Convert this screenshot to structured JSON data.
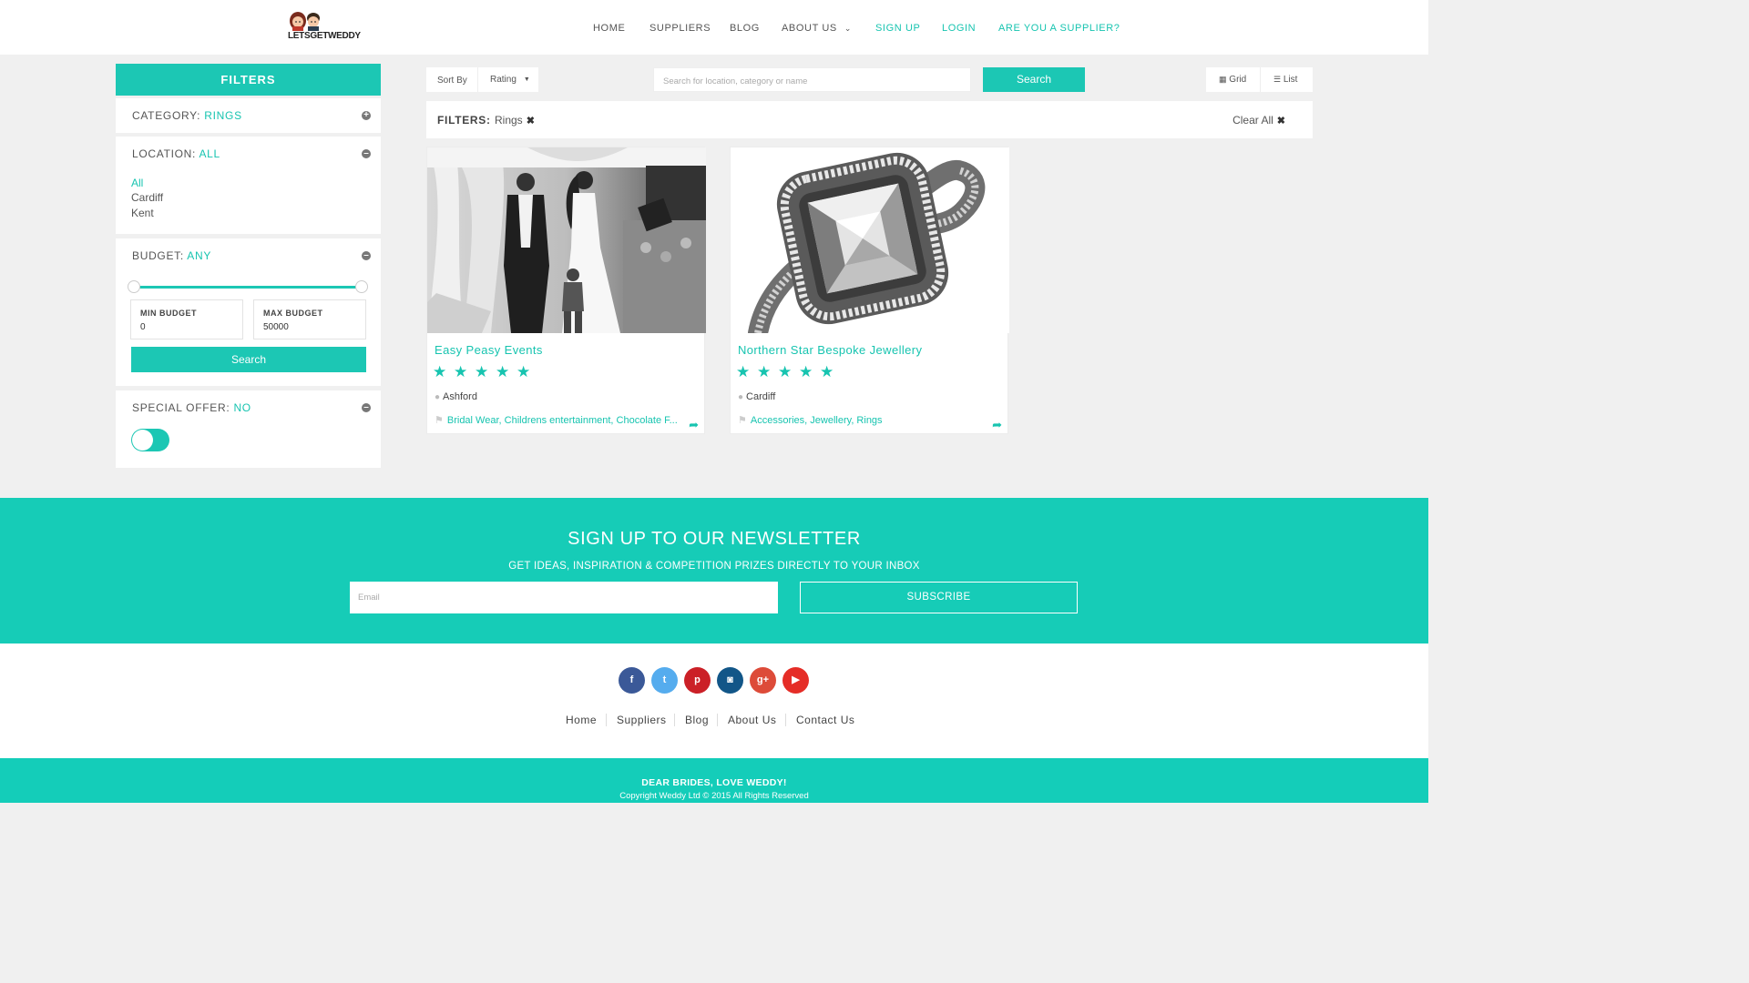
{
  "brand": {
    "logo_text": "LETSGETWEDDY"
  },
  "nav": {
    "home": "HOME",
    "suppliers": "SUPPLIERS",
    "blog": "BLOG",
    "about": "ABOUT US",
    "signup": "SIGN UP",
    "login": "LOGIN",
    "supplier": "ARE YOU A SUPPLIER?"
  },
  "sidebar": {
    "header": "FILTERS",
    "category": {
      "label": "CATEGORY:",
      "value": "RINGS"
    },
    "location": {
      "label": "LOCATION:",
      "value": "ALL",
      "items": [
        "All",
        "Cardiff",
        "Kent"
      ]
    },
    "budget": {
      "label": "BUDGET:",
      "value": "ANY",
      "min_label": "MIN BUDGET",
      "min_value": "0",
      "max_label": "MAX BUDGET",
      "max_value": "50000",
      "search_label": "Search",
      "range_fraction": [
        0.0,
        1.0
      ]
    },
    "special_offer": {
      "label": "SPECIAL OFFER:",
      "value": "NO",
      "toggle_on": true
    }
  },
  "toolbar": {
    "sort_label": "Sort By",
    "sort_value": "Rating",
    "search_placeholder": "Search for location, category or name",
    "search_button": "Search",
    "grid_label": "Grid",
    "list_label": "List"
  },
  "filterbar": {
    "label": "FILTERS:",
    "chip": "Rings",
    "clear": "Clear All"
  },
  "results": [
    {
      "name": "Easy Peasy Events",
      "rating": 5,
      "location": "Ashford",
      "tags": "Bridal Wear, Childrens entertainment, Chocolate F..."
    },
    {
      "name": "Northern Star Bespoke Jewellery",
      "rating": 5,
      "location": "Cardiff",
      "tags": "Accessories, Jewellery, Rings"
    }
  ],
  "newsletter": {
    "title": "SIGN UP TO OUR NEWSLETTER",
    "subtitle": "GET IDEAS, INSPIRATION & COMPETITION PRIZES DIRECTLY TO YOUR INBOX",
    "email_placeholder": "Email",
    "button": "SUBSCRIBE"
  },
  "social": [
    {
      "name": "facebook",
      "glyph": "f",
      "color": "#3b5998"
    },
    {
      "name": "twitter",
      "glyph": "t",
      "color": "#55acee"
    },
    {
      "name": "pinterest",
      "glyph": "p",
      "color": "#cb2027"
    },
    {
      "name": "instagram",
      "glyph": "◙",
      "color": "#125688"
    },
    {
      "name": "google-plus",
      "glyph": "g+",
      "color": "#dd4b39"
    },
    {
      "name": "youtube",
      "glyph": "▶",
      "color": "#e52d27"
    }
  ],
  "footer": {
    "links": [
      "Home",
      "Suppliers",
      "Blog",
      "About Us",
      "Contact Us"
    ],
    "tagline": "DEAR BRIDES, LOVE WEDDY!",
    "copyright": "Copyright Weddy Ltd © 2015 All Rights Reserved"
  },
  "colors": {
    "accent": "#1cc7b4",
    "background": "#f0f0f0"
  }
}
